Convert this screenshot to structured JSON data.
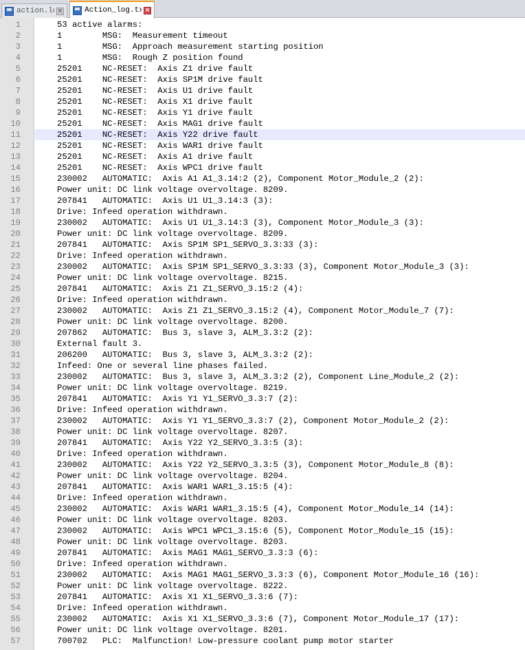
{
  "tabs": [
    {
      "label": "action.log",
      "active": false
    },
    {
      "label": "Action_log.txt",
      "active": true
    }
  ],
  "current_line": 11,
  "lines": [
    "53 active alarms:",
    "1        MSG:  Measurement timeout",
    "1        MSG:  Approach measurement starting position",
    "1        MSG:  Rough Z position found",
    "25201    NC-RESET:  Axis Z1 drive fault",
    "25201    NC-RESET:  Axis SP1M drive fault",
    "25201    NC-RESET:  Axis U1 drive fault",
    "25201    NC-RESET:  Axis X1 drive fault",
    "25201    NC-RESET:  Axis Y1 drive fault",
    "25201    NC-RESET:  Axis MAG1 drive fault",
    "25201    NC-RESET:  Axis Y22 drive fault",
    "25201    NC-RESET:  Axis WAR1 drive fault",
    "25201    NC-RESET:  Axis A1 drive fault",
    "25201    NC-RESET:  Axis WPC1 drive fault",
    "230002   AUTOMATIC:  Axis A1 A1_3.14:2 (2), Component Motor_Module_2 (2):",
    "Power unit: DC link voltage overvoltage. 8209.",
    "207841   AUTOMATIC:  Axis U1 U1_3.14:3 (3):",
    "Drive: Infeed operation withdrawn.",
    "230002   AUTOMATIC:  Axis U1 U1_3.14:3 (3), Component Motor_Module_3 (3):",
    "Power unit: DC link voltage overvoltage. 8209.",
    "207841   AUTOMATIC:  Axis SP1M SP1_SERVO_3.3:33 (3):",
    "Drive: Infeed operation withdrawn.",
    "230002   AUTOMATIC:  Axis SP1M SP1_SERVO_3.3:33 (3), Component Motor_Module_3 (3):",
    "Power unit: DC link voltage overvoltage. 8215.",
    "207841   AUTOMATIC:  Axis Z1 Z1_SERVO_3.15:2 (4):",
    "Drive: Infeed operation withdrawn.",
    "230002   AUTOMATIC:  Axis Z1 Z1_SERVO_3.15:2 (4), Component Motor_Module_7 (7):",
    "Power unit: DC link voltage overvoltage. 8200.",
    "207862   AUTOMATIC:  Bus 3, slave 3, ALM_3.3:2 (2):",
    "External fault 3.",
    "206200   AUTOMATIC:  Bus 3, slave 3, ALM_3.3:2 (2):",
    "Infeed: One or several line phases failed.",
    "230002   AUTOMATIC:  Bus 3, slave 3, ALM_3.3:2 (2), Component Line_Module_2 (2):",
    "Power unit: DC link voltage overvoltage. 8219.",
    "207841   AUTOMATIC:  Axis Y1 Y1_SERVO_3.3:7 (2):",
    "Drive: Infeed operation withdrawn.",
    "230002   AUTOMATIC:  Axis Y1 Y1_SERVO_3.3:7 (2), Component Motor_Module_2 (2):",
    "Power unit: DC link voltage overvoltage. 8207.",
    "207841   AUTOMATIC:  Axis Y22 Y2_SERVO_3.3:5 (3):",
    "Drive: Infeed operation withdrawn.",
    "230002   AUTOMATIC:  Axis Y22 Y2_SERVO_3.3:5 (3), Component Motor_Module_8 (8):",
    "Power unit: DC link voltage overvoltage. 8204.",
    "207841   AUTOMATIC:  Axis WAR1 WAR1_3.15:5 (4):",
    "Drive: Infeed operation withdrawn.",
    "230002   AUTOMATIC:  Axis WAR1 WAR1_3.15:5 (4), Component Motor_Module_14 (14):",
    "Power unit: DC link voltage overvoltage. 8203.",
    "230002   AUTOMATIC:  Axis WPC1 WPC1_3.15:6 (5), Component Motor_Module_15 (15):",
    "Power unit: DC link voltage overvoltage. 8203.",
    "207841   AUTOMATIC:  Axis MAG1 MAG1_SERVO_3.3:3 (6):",
    "Drive: Infeed operation withdrawn.",
    "230002   AUTOMATIC:  Axis MAG1 MAG1_SERVO_3.3:3 (6), Component Motor_Module_16 (16):",
    "Power unit: DC link voltage overvoltage. 8222.",
    "207841   AUTOMATIC:  Axis X1 X1_SERVO_3.3:6 (7):",
    "Drive: Infeed operation withdrawn.",
    "230002   AUTOMATIC:  Axis X1 X1_SERVO_3.3:6 (7), Component Motor_Module_17 (17):",
    "Power unit: DC link voltage overvoltage. 8201.",
    "700702   PLC:  Malfunction! Low-pressure coolant pump motor starter"
  ]
}
